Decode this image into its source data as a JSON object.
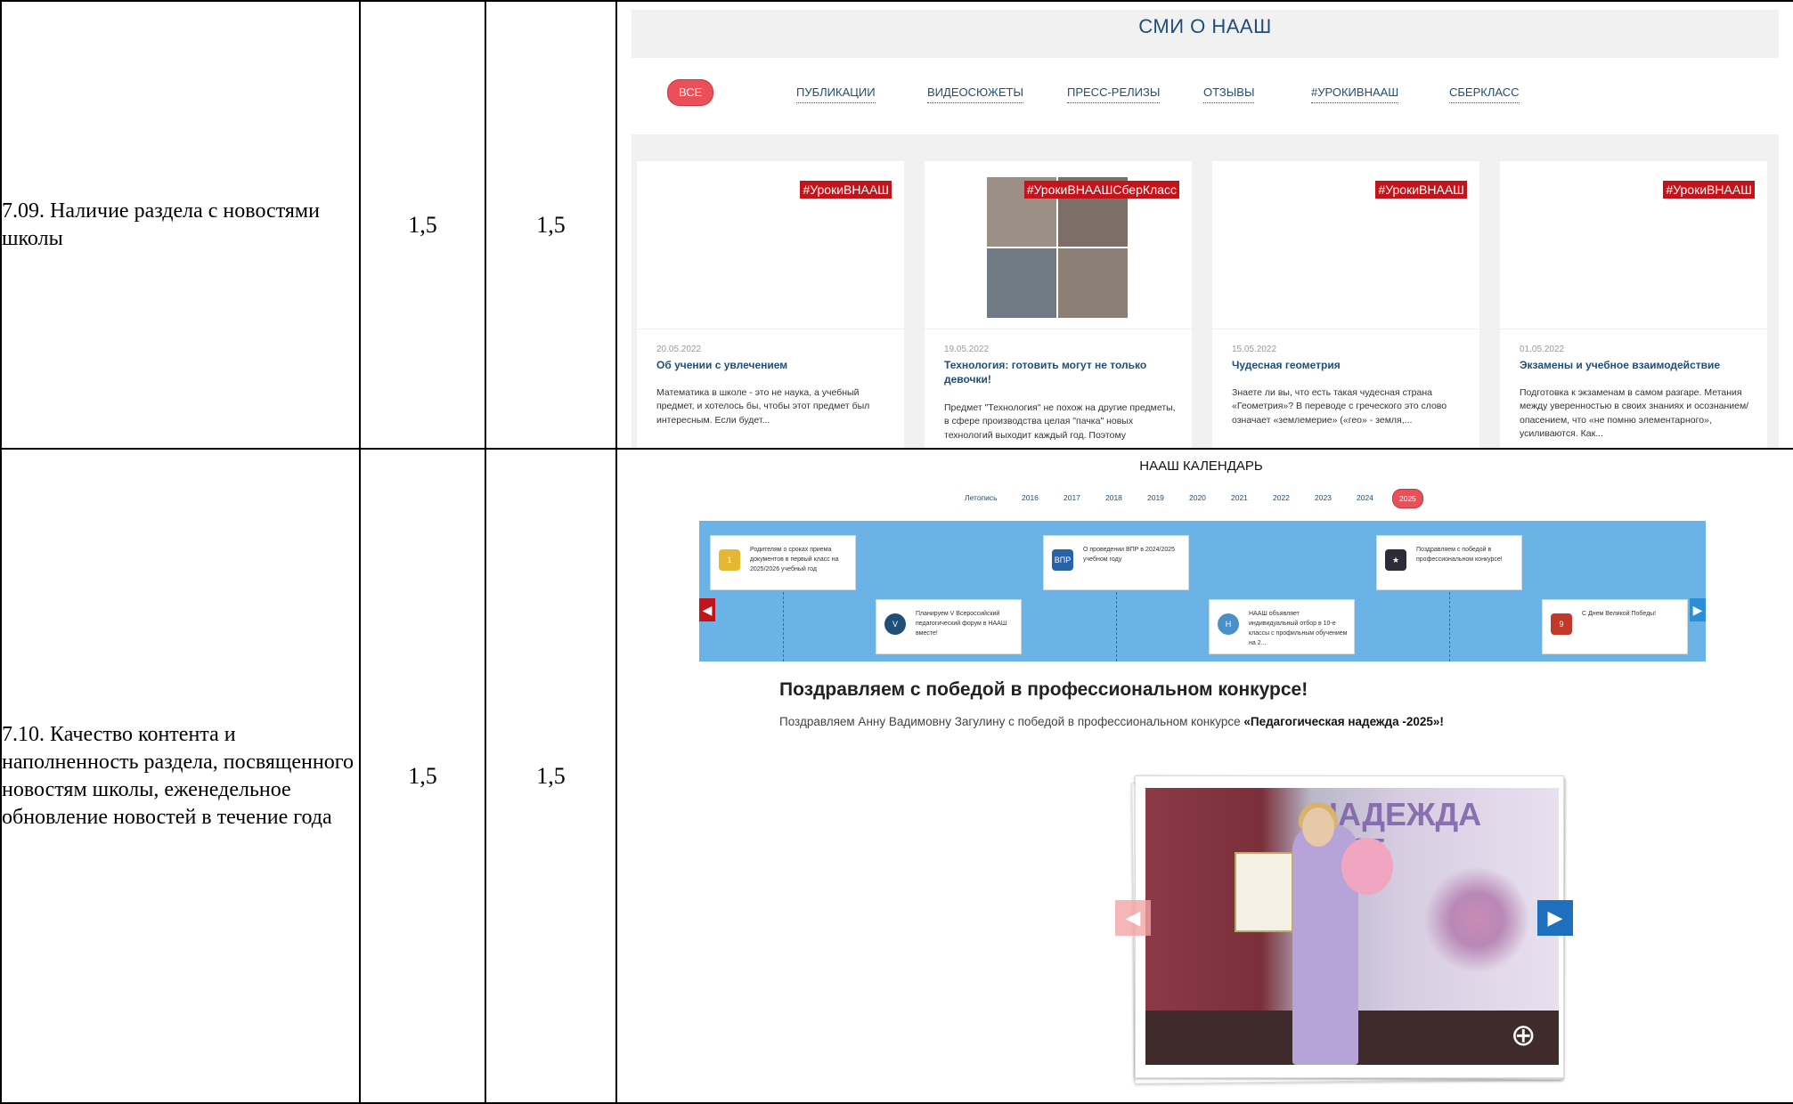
{
  "rows": [
    {
      "criterion": "7.09. Наличие раздела с новостями школы",
      "score_a": "1,5",
      "score_b": "1,5"
    },
    {
      "criterion": "7.10. Качество контента и наполненность раздела, посвященного новостям школы, еженедельное обновление новостей в течение года",
      "score_a": "1,5",
      "score_b": "1,5"
    }
  ],
  "smi": {
    "heading": "СМИ О НААШ",
    "tabs": [
      "ВСЕ",
      "ПУБЛИКАЦИИ",
      "ВИДЕОСЮЖЕТЫ",
      "ПРЕСС-РЕЛИЗЫ",
      "ОТЗЫВЫ",
      "#УРОКИВНААШ",
      "СБЕРКЛАСС"
    ],
    "cards": [
      {
        "tag": "#УрокиВНААШ",
        "date": "20.05.2022",
        "title": "Об учении с увлечением",
        "text": "Математика в школе - это не наука, а учебный предмет, и хотелось бы, чтобы этот предмет был интересным. Если будет..."
      },
      {
        "tag": "#УрокиВНААШСберКласс",
        "date": "19.05.2022",
        "title": "Технология: готовить могут не только девочки!",
        "text": "Предмет \"Технология\" не похож на другие предметы, в сфере производства целая \"пачка\" новых технологий выходит каждый год. Поэтому"
      },
      {
        "tag": "#УрокиВНААШ",
        "date": "15.05.2022",
        "title": "Чудесная геометрия",
        "text": "Знаете ли вы, что есть такая чудесная страна «Геометрия»? В переводе с греческого это слово означает «землемерие» («гео» - земля,..."
      },
      {
        "tag": "#УрокиВНААШ",
        "date": "01.05.2022",
        "title": "Экзамены и учебное взаимодействие",
        "text": "Подготовка к экзаменам в самом разгаре. Метания между уверенностью в своих знаниях и осознанием/опасением, что «не помню элементарного», усиливаются. Как..."
      }
    ]
  },
  "calendar": {
    "heading": "НААШ КАЛЕНДАРЬ",
    "years": [
      "Летопись",
      "2016",
      "2017",
      "2018",
      "2019",
      "2020",
      "2021",
      "2022",
      "2023",
      "2024",
      "2025"
    ],
    "events": [
      {
        "text": "Родителям о сроках приема документов в первый класс на 2025/2026 учебный год",
        "icon_label": "1"
      },
      {
        "text": "Планируем V Всероссийский педагогический форум в НААШ вместе!",
        "icon_label": "V"
      },
      {
        "text": "О проведении ВПР в 2024/2025 учебном году",
        "icon_label": "ВПР"
      },
      {
        "text": "НААШ объявляет индивидуальный отбор в 10-е классы с профильным обучением на 2...",
        "icon_label": "Н"
      },
      {
        "text": "Поздравляем с победой в профессиональном конкурсе!",
        "icon_label": "★"
      },
      {
        "text": "С Днем Великой Победы!",
        "icon_label": "9"
      }
    ],
    "news_title": "Поздравляем с победой в профессиональном конкурсе!",
    "news_text": "Поздравляем Анну Вадимовну Загулину с победой в профессиональном конкурсе ",
    "news_text_bold": "«Педагогическая надежда -2025»!",
    "photo_banner": "НАДЕЖДА 2025"
  },
  "colors": {
    "accent_red": "#e9505a",
    "tag_red": "#c4141b",
    "link_blue": "#1f4e79",
    "timeline_blue": "#6bb3e6"
  }
}
